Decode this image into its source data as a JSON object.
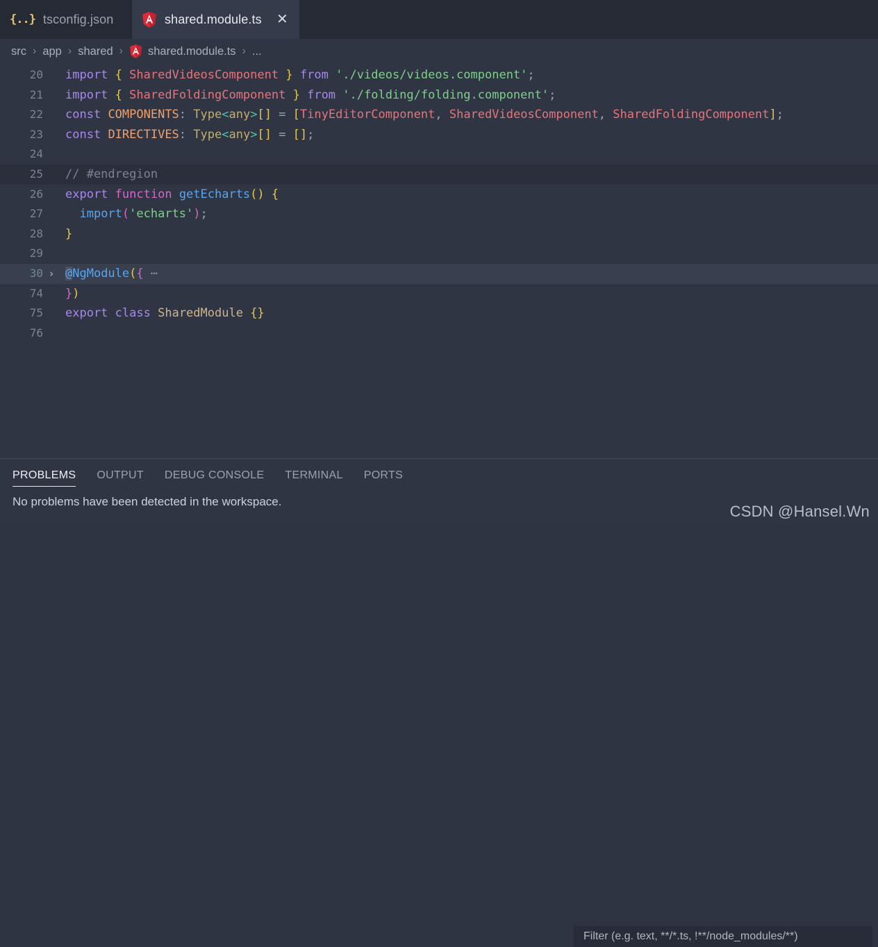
{
  "tabs": [
    {
      "label": "tsconfig.json",
      "icon": "json-braces-icon",
      "active": false,
      "closable": false
    },
    {
      "label": "shared.module.ts",
      "icon": "angular-icon",
      "active": true,
      "closable": true,
      "close_glyph": "✕"
    }
  ],
  "breadcrumb": {
    "separator": "›",
    "items": [
      {
        "label": "src",
        "icon": null
      },
      {
        "label": "app",
        "icon": null
      },
      {
        "label": "shared",
        "icon": null
      },
      {
        "label": "shared.module.ts",
        "icon": "angular-icon"
      },
      {
        "label": "...",
        "icon": null
      }
    ]
  },
  "editor": {
    "lines": [
      {
        "num": "20",
        "fold": "",
        "highlight": "none",
        "tokens": [
          {
            "t": "import",
            "c": "t-kw"
          },
          {
            "t": " ",
            "c": ""
          },
          {
            "t": "{",
            "c": "t-brace"
          },
          {
            "t": " ",
            "c": ""
          },
          {
            "t": "SharedVideosComponent",
            "c": "t-cls"
          },
          {
            "t": " ",
            "c": ""
          },
          {
            "t": "}",
            "c": "t-brace"
          },
          {
            "t": " ",
            "c": ""
          },
          {
            "t": "from",
            "c": "t-kw"
          },
          {
            "t": " ",
            "c": ""
          },
          {
            "t": "'./videos/videos.component'",
            "c": "t-str"
          },
          {
            "t": ";",
            "c": "t-op"
          }
        ]
      },
      {
        "num": "21",
        "fold": "",
        "highlight": "none",
        "tokens": [
          {
            "t": "import",
            "c": "t-kw"
          },
          {
            "t": " ",
            "c": ""
          },
          {
            "t": "{",
            "c": "t-brace"
          },
          {
            "t": " ",
            "c": ""
          },
          {
            "t": "SharedFoldingComponent",
            "c": "t-cls"
          },
          {
            "t": " ",
            "c": ""
          },
          {
            "t": "}",
            "c": "t-brace"
          },
          {
            "t": " ",
            "c": ""
          },
          {
            "t": "from",
            "c": "t-kw"
          },
          {
            "t": " ",
            "c": ""
          },
          {
            "t": "'./folding/folding.component'",
            "c": "t-str"
          },
          {
            "t": ";",
            "c": "t-op"
          }
        ]
      },
      {
        "num": "22",
        "fold": "",
        "highlight": "none",
        "tokens": [
          {
            "t": "const",
            "c": "t-kw"
          },
          {
            "t": " ",
            "c": ""
          },
          {
            "t": "COMPONENTS",
            "c": "t-var"
          },
          {
            "t": ": ",
            "c": "t-op"
          },
          {
            "t": "Type",
            "c": "t-type"
          },
          {
            "t": "<",
            "c": "t-angle"
          },
          {
            "t": "any",
            "c": "t-type"
          },
          {
            "t": ">",
            "c": "t-angle"
          },
          {
            "t": "[]",
            "c": "t-brace"
          },
          {
            "t": " = ",
            "c": "t-op"
          },
          {
            "t": "[",
            "c": "t-brace"
          },
          {
            "t": "TinyEditorComponent",
            "c": "t-cls"
          },
          {
            "t": ", ",
            "c": "t-op"
          },
          {
            "t": "SharedVideosComponent",
            "c": "t-cls"
          },
          {
            "t": ", ",
            "c": "t-op"
          },
          {
            "t": "SharedFoldingComponent",
            "c": "t-cls"
          },
          {
            "t": "]",
            "c": "t-brace"
          },
          {
            "t": ";",
            "c": "t-op"
          }
        ]
      },
      {
        "num": "23",
        "fold": "",
        "highlight": "none",
        "tokens": [
          {
            "t": "const",
            "c": "t-kw"
          },
          {
            "t": " ",
            "c": ""
          },
          {
            "t": "DIRECTIVES",
            "c": "t-var"
          },
          {
            "t": ": ",
            "c": "t-op"
          },
          {
            "t": "Type",
            "c": "t-type"
          },
          {
            "t": "<",
            "c": "t-angle"
          },
          {
            "t": "any",
            "c": "t-type"
          },
          {
            "t": ">",
            "c": "t-angle"
          },
          {
            "t": "[]",
            "c": "t-brace"
          },
          {
            "t": " = ",
            "c": "t-op"
          },
          {
            "t": "[]",
            "c": "t-brace"
          },
          {
            "t": ";",
            "c": "t-op"
          }
        ]
      },
      {
        "num": "24",
        "fold": "",
        "highlight": "none",
        "tokens": []
      },
      {
        "num": "25",
        "fold": "",
        "highlight": "region",
        "tokens": [
          {
            "t": "// #endregion",
            "c": "t-comment"
          }
        ]
      },
      {
        "num": "26",
        "fold": "",
        "highlight": "none",
        "tokens": [
          {
            "t": "export",
            "c": "t-kw"
          },
          {
            "t": " ",
            "c": ""
          },
          {
            "t": "function",
            "c": "t-kw2"
          },
          {
            "t": " ",
            "c": ""
          },
          {
            "t": "getEcharts",
            "c": "t-fn"
          },
          {
            "t": "()",
            "c": "t-brace"
          },
          {
            "t": " ",
            "c": ""
          },
          {
            "t": "{",
            "c": "t-brace"
          }
        ]
      },
      {
        "num": "27",
        "fold": "",
        "highlight": "none",
        "tokens": [
          {
            "t": "  ",
            "c": ""
          },
          {
            "t": "import",
            "c": "t-fn"
          },
          {
            "t": "(",
            "c": "t-paren-m"
          },
          {
            "t": "'echarts'",
            "c": "t-str"
          },
          {
            "t": ")",
            "c": "t-paren-m"
          },
          {
            "t": ";",
            "c": "t-op"
          }
        ]
      },
      {
        "num": "28",
        "fold": "",
        "highlight": "none",
        "tokens": [
          {
            "t": "}",
            "c": "t-brace"
          }
        ]
      },
      {
        "num": "29",
        "fold": "",
        "highlight": "none",
        "tokens": []
      },
      {
        "num": "30",
        "fold": "›",
        "highlight": "folded",
        "tokens": [
          {
            "t": "@",
            "c": "t-at"
          },
          {
            "t": "NgModule",
            "c": "t-dec"
          },
          {
            "t": "(",
            "c": "t-brace"
          },
          {
            "t": "{",
            "c": "t-paren-m"
          },
          {
            "t": " ⋯",
            "c": "t-dots"
          }
        ]
      },
      {
        "num": "74",
        "fold": "",
        "highlight": "none",
        "tokens": [
          {
            "t": "}",
            "c": "t-paren-m"
          },
          {
            "t": ")",
            "c": "t-brace"
          }
        ]
      },
      {
        "num": "75",
        "fold": "",
        "highlight": "none",
        "tokens": [
          {
            "t": "export",
            "c": "t-kw"
          },
          {
            "t": " ",
            "c": ""
          },
          {
            "t": "class",
            "c": "t-kw"
          },
          {
            "t": " ",
            "c": ""
          },
          {
            "t": "SharedModule",
            "c": "t-id"
          },
          {
            "t": " ",
            "c": ""
          },
          {
            "t": "{}",
            "c": "t-brace"
          }
        ]
      },
      {
        "num": "76",
        "fold": "",
        "highlight": "none",
        "tokens": []
      }
    ]
  },
  "panel": {
    "tabs": [
      {
        "label": "PROBLEMS",
        "active": true
      },
      {
        "label": "OUTPUT",
        "active": false
      },
      {
        "label": "DEBUG CONSOLE",
        "active": false
      },
      {
        "label": "TERMINAL",
        "active": false
      },
      {
        "label": "PORTS",
        "active": false
      }
    ],
    "filter": {
      "value": "",
      "placeholder": "Filter (e.g. text, **/*.ts, !**/node_modules/**)"
    },
    "message": "No problems have been detected in the workspace."
  },
  "watermark": "CSDN @Hansel.Wn",
  "colors": {
    "editor_bg": "#2f3542",
    "tabbar_bg": "#252a35",
    "active_tab_bg": "#353b4a",
    "panel_border": "#454b59",
    "angular_red": "#dd2c35",
    "json_yellow": "#e5c07b",
    "region_highlight": "#2a2f3b",
    "folded_highlight": "#383f4e"
  }
}
